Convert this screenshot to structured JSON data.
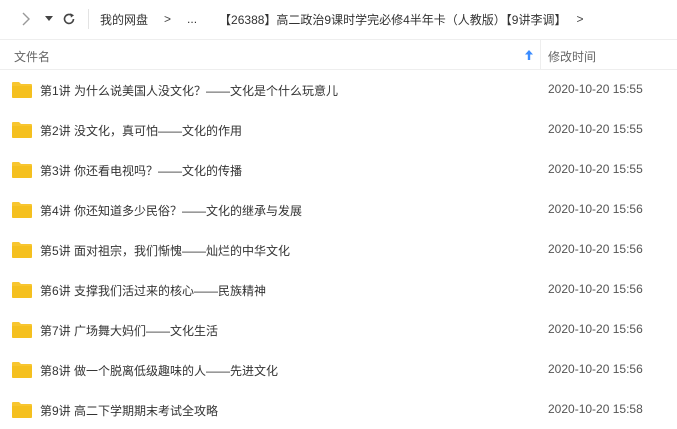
{
  "nav": {
    "forward_icon": "chevron-right-icon",
    "dropdown_icon": "triangle-down-icon",
    "refresh_icon": "refresh-icon"
  },
  "breadcrumb": {
    "root": "我的网盘",
    "separator": ">",
    "ellipsis": "...",
    "current": "【26388】高二政治9课时学完必修4半年卡（人教版）【9讲李调】",
    "trailing": ">"
  },
  "header": {
    "name_label": "文件名",
    "time_label": "修改时间",
    "sort_icon": "sort-up-arrow-icon"
  },
  "colors": {
    "folder": "#f8c630",
    "folder_dark": "#f0b400",
    "sort_arrow": "#3b8cff",
    "text": "#333333"
  },
  "files": [
    {
      "name": "第1讲 为什么说美国人没文化？——文化是个什么玩意儿",
      "time": "2020-10-20 15:55"
    },
    {
      "name": "第2讲 没文化，真可怕——文化的作用",
      "time": "2020-10-20 15:55"
    },
    {
      "name": "第3讲 你还看电视吗？——文化的传播",
      "time": "2020-10-20 15:55"
    },
    {
      "name": "第4讲 你还知道多少民俗？——文化的继承与发展",
      "time": "2020-10-20 15:56"
    },
    {
      "name": "第5讲 面对祖宗，我们惭愧——灿烂的中华文化",
      "time": "2020-10-20 15:56"
    },
    {
      "name": "第6讲 支撑我们活过来的核心——民族精神",
      "time": "2020-10-20 15:56"
    },
    {
      "name": "第7讲 广场舞大妈们——文化生活",
      "time": "2020-10-20 15:56"
    },
    {
      "name": "第8讲 做一个脱离低级趣味的人——先进文化",
      "time": "2020-10-20 15:56"
    },
    {
      "name": "第9讲 高二下学期期末考试全攻略",
      "time": "2020-10-20 15:58"
    }
  ]
}
